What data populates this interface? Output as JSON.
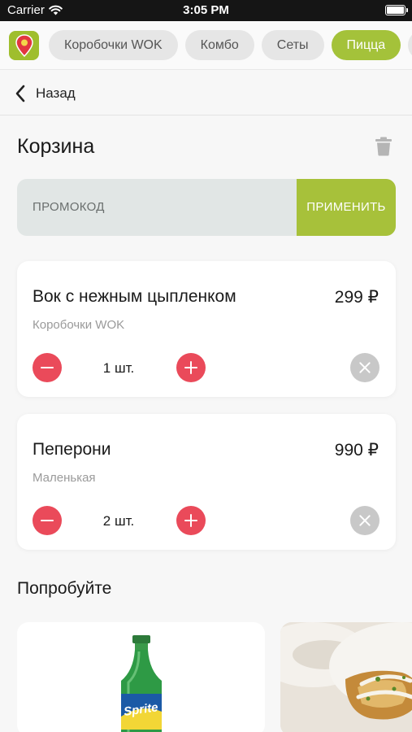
{
  "status_bar": {
    "carrier": "Carrier",
    "time": "3:05 PM"
  },
  "categories": {
    "items": [
      {
        "label": "Коробочки WOK"
      },
      {
        "label": "Комбо"
      },
      {
        "label": "Сеты"
      },
      {
        "label": "Пицца",
        "active": true
      }
    ]
  },
  "nav": {
    "back_label": "Назад"
  },
  "cart": {
    "title": "Корзина",
    "promo": {
      "placeholder": "ПРОМОКОД",
      "apply_label": "ПРИМЕНИТЬ"
    },
    "items": [
      {
        "name": "Вок с нежным цыпленком",
        "price": "299 ₽",
        "subtitle": "Коробочки WOK",
        "quantity": "1 шт."
      },
      {
        "name": "Пеперони",
        "price": "990 ₽",
        "subtitle": "Маленькая",
        "quantity": "2 шт."
      }
    ]
  },
  "recommendations": {
    "title": "Попробуйте",
    "products": [
      {
        "image": "sprite-bottle",
        "brand": "Sprite"
      },
      {
        "image": "food-dish"
      }
    ]
  },
  "colors": {
    "accent_green": "#a4c23a",
    "danger_red": "#ea4a5a",
    "muted_gray": "#c8c8c8"
  }
}
